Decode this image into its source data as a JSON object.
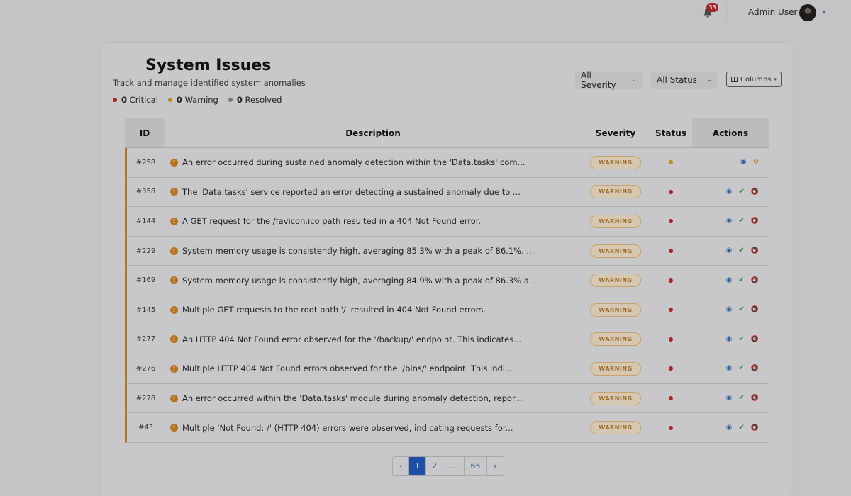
{
  "topbar": {
    "notification_count": "33",
    "user_name": "Admin User",
    "user_caret": "▾"
  },
  "header": {
    "title": "System Issues",
    "subtitle": "Track and manage identified system anomalies",
    "stats": [
      {
        "count": "0",
        "label": "Critical",
        "color": "#a3262a"
      },
      {
        "count": "0",
        "label": "Warning",
        "color": "#b88a1a"
      },
      {
        "count": "0",
        "label": "Resolved",
        "color": "#777777"
      }
    ]
  },
  "filters": {
    "severity": "All Severity",
    "status": "All Status",
    "columns": "Columns"
  },
  "table": {
    "headers": {
      "id": "ID",
      "description": "Description",
      "severity": "Severity",
      "status": "Status",
      "actions": "Actions"
    },
    "rows": [
      {
        "id": "#258",
        "description": "An error occurred during sustained anomaly detection within the 'Data.tasks' com...",
        "severity": "WARNING",
        "status_color": "#b88a1a",
        "actions": [
          "eye",
          "refresh"
        ]
      },
      {
        "id": "#358",
        "description": "The 'Data.tasks' service reported an error detecting a sustained anomaly due to ...",
        "severity": "WARNING",
        "status_color": "#a3262a",
        "actions": [
          "eye",
          "check",
          "mute"
        ]
      },
      {
        "id": "#144",
        "description": "A GET request for the /favicon.ico path resulted in a 404 Not Found error.",
        "severity": "WARNING",
        "status_color": "#a3262a",
        "actions": [
          "eye",
          "check",
          "mute"
        ]
      },
      {
        "id": "#229",
        "description": "System memory usage is consistently high, averaging 85.3% with a peak of 86.1%. ...",
        "severity": "WARNING",
        "status_color": "#a3262a",
        "actions": [
          "eye",
          "check",
          "mute"
        ]
      },
      {
        "id": "#169",
        "description": "System memory usage is consistently high, averaging 84.9% with a peak of 86.3% a...",
        "severity": "WARNING",
        "status_color": "#a3262a",
        "actions": [
          "eye",
          "check",
          "mute"
        ]
      },
      {
        "id": "#145",
        "description": "Multiple GET requests to the root path '/' resulted in 404 Not Found errors.",
        "severity": "WARNING",
        "status_color": "#a3262a",
        "actions": [
          "eye",
          "check",
          "mute"
        ]
      },
      {
        "id": "#277",
        "description": "An HTTP 404 Not Found error observed for the '/backup/' endpoint. This indicates...",
        "severity": "WARNING",
        "status_color": "#a3262a",
        "actions": [
          "eye",
          "check",
          "mute"
        ]
      },
      {
        "id": "#276",
        "description": "Multiple HTTP 404 Not Found errors observed for the '/bins/' endpoint. This indi...",
        "severity": "WARNING",
        "status_color": "#a3262a",
        "actions": [
          "eye",
          "check",
          "mute"
        ]
      },
      {
        "id": "#278",
        "description": "An error occurred within the 'Data.tasks' module during anomaly detection, repor...",
        "severity": "WARNING",
        "status_color": "#a3262a",
        "actions": [
          "eye",
          "check",
          "mute"
        ]
      },
      {
        "id": "#43",
        "description": "Multiple 'Not Found: /' (HTTP 404) errors were observed, indicating requests for...",
        "severity": "WARNING",
        "status_color": "#a3262a",
        "actions": [
          "eye",
          "check",
          "mute"
        ]
      }
    ]
  },
  "pagination": {
    "prev": "‹",
    "pages": [
      "1",
      "2",
      "...",
      "65"
    ],
    "active": "1",
    "next": "›"
  }
}
